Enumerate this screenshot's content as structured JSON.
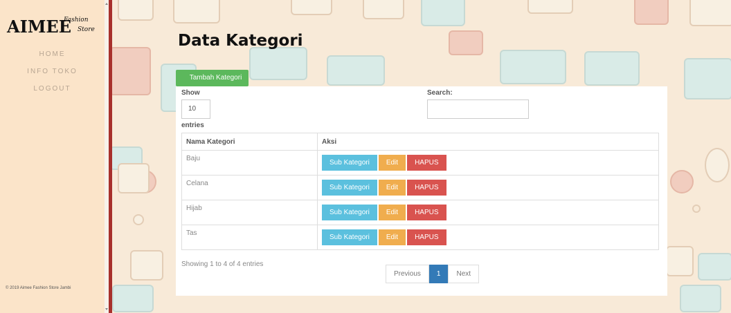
{
  "brand": {
    "main": "AIMEE",
    "sub_top": "Fashion",
    "sub_bottom": "Store"
  },
  "nav": {
    "items": [
      "HOME",
      "INFO TOKO",
      "LOGOUT"
    ]
  },
  "footer": "© 2019 Aimee Fashion Store Jambi",
  "page_title": "Data Kategori",
  "add_button": "Tambah Kategori",
  "table_controls": {
    "show_label": "Show",
    "length_value": "10",
    "entries_label": "entries",
    "search_label": "Search:",
    "search_value": ""
  },
  "table": {
    "headers": [
      "Nama Kategori",
      "Aksi"
    ],
    "rows": [
      {
        "name": "Baju"
      },
      {
        "name": "Celana"
      },
      {
        "name": "Hijab"
      },
      {
        "name": "Tas"
      }
    ],
    "actions": {
      "sub": "Sub Kategori",
      "edit": "Edit",
      "delete": "HAPUS"
    }
  },
  "info": "Showing 1 to 4 of 4 entries",
  "pagination": {
    "previous": "Previous",
    "current": "1",
    "next": "Next"
  },
  "colors": {
    "sidebar_bg": "#fbe4c9",
    "accent_red": "#a8302c",
    "add_button": "#5cb85c",
    "btn_info": "#5bc0de",
    "btn_warning": "#f0ad4e",
    "btn_danger": "#d9534f",
    "page_active": "#337ab7"
  }
}
